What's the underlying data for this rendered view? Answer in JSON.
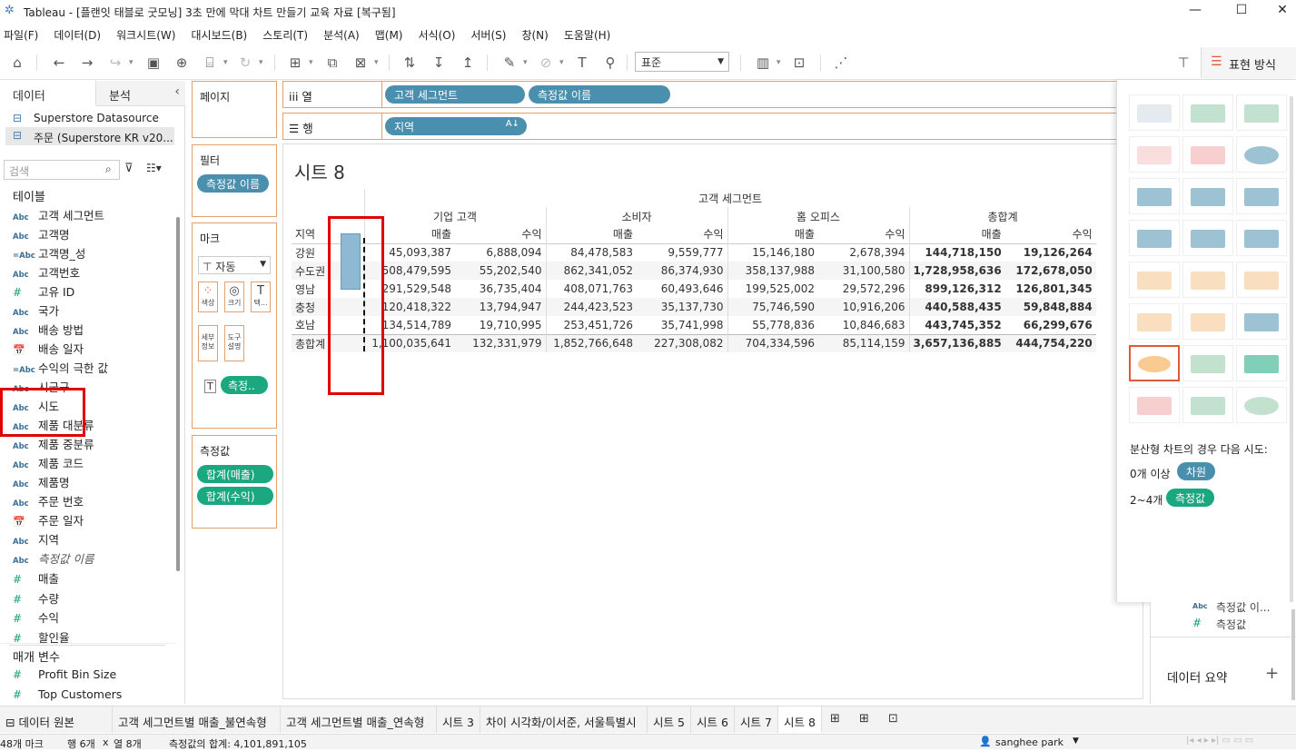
{
  "window": {
    "title": "Tableau - [플랜잇 태블로 굿모닝] 3초 만에 막대 차트 만들기 교육 자료 [복구됨]",
    "min": "—",
    "max": "☐",
    "close": "✕"
  },
  "menu": [
    "파일(F)",
    "데이터(D)",
    "워크시트(W)",
    "대시보드(B)",
    "스토리(T)",
    "분석(A)",
    "맵(M)",
    "서식(O)",
    "서버(S)",
    "창(N)",
    "도움말(H)"
  ],
  "toolbar": {
    "standard": "표준",
    "format_label": "표현 방식"
  },
  "left": {
    "tab_data": "데이터",
    "tab_analysis": "분석",
    "datasources": [
      "Superstore Datasource",
      "주문 (Superstore KR v20..."
    ],
    "search_placeholder": "검색",
    "tables_header": "테이블",
    "fields": [
      {
        "icon": "Abc",
        "name": "고객 세그먼트"
      },
      {
        "icon": "Abc",
        "name": "고객명"
      },
      {
        "icon": "=Abc",
        "name": "고객명_성"
      },
      {
        "icon": "Abc",
        "name": "고객번호"
      },
      {
        "icon": "#",
        "name": "고유 ID"
      },
      {
        "icon": "Abc",
        "name": "국가"
      },
      {
        "icon": "Abc",
        "name": "배송 방법"
      },
      {
        "icon": "cal",
        "name": "배송 일자"
      },
      {
        "icon": "=Abc",
        "name": "수익의 극한 값"
      },
      {
        "icon": "Abc",
        "name": "시군구"
      },
      {
        "icon": "Abc",
        "name": "시도"
      },
      {
        "icon": "Abc",
        "name": "제품 대분류"
      },
      {
        "icon": "Abc",
        "name": "제품 중분류"
      },
      {
        "icon": "Abc",
        "name": "제품 코드"
      },
      {
        "icon": "Abc",
        "name": "제품명"
      },
      {
        "icon": "Abc",
        "name": "주문 번호"
      },
      {
        "icon": "cal",
        "name": "주문 일자"
      },
      {
        "icon": "Abc",
        "name": "지역"
      },
      {
        "icon": "Abc",
        "name": "측정값 이름"
      }
    ],
    "measures": [
      {
        "icon": "#",
        "name": "매출"
      },
      {
        "icon": "#",
        "name": "수량"
      },
      {
        "icon": "#",
        "name": "수익"
      },
      {
        "icon": "#",
        "name": "할인율"
      }
    ],
    "params_header": "매개 변수",
    "params": [
      {
        "icon": "#",
        "name": "Profit Bin Size"
      },
      {
        "icon": "#",
        "name": "Top Customers"
      }
    ]
  },
  "cards": {
    "pages": "페이지",
    "filters": "필터",
    "filter_pill": "측정값 이름",
    "marks": "마크",
    "marks_type": "자동",
    "mark_btns": [
      "색상",
      "크기",
      "텍...",
      "세부\n정보",
      "도구\n설명"
    ],
    "marks_pill": "측정..",
    "measures": "측정값",
    "measure_pills": [
      "합계(매출)",
      "합계(수익)"
    ]
  },
  "shelves": {
    "columns_label": "열",
    "rows_label": "행",
    "columns": [
      "고객 세그먼트",
      "측정값 이름"
    ],
    "rows": [
      "지역"
    ]
  },
  "sheet": {
    "title": "시트 8"
  },
  "crosstab": {
    "top_header": "고객 세그먼트",
    "row_header": "지역",
    "segments": [
      "기업 고객",
      "소비자",
      "홈 오피스",
      "총합계"
    ],
    "measures": [
      "매출",
      "수익"
    ],
    "rows": [
      {
        "region": "강원",
        "values": [
          "45,093,387",
          "6,888,094",
          "84,478,583",
          "9,559,777",
          "15,146,180",
          "2,678,394",
          "144,718,150",
          "19,126,264"
        ]
      },
      {
        "region": "수도권",
        "values": [
          "508,479,595",
          "55,202,540",
          "862,341,052",
          "86,374,930",
          "358,137,988",
          "31,100,580",
          "1,728,958,636",
          "172,678,050"
        ]
      },
      {
        "region": "영남",
        "values": [
          "291,529,548",
          "36,735,404",
          "408,071,763",
          "60,493,646",
          "199,525,002",
          "29,572,296",
          "899,126,312",
          "126,801,345"
        ]
      },
      {
        "region": "충청",
        "values": [
          "120,418,322",
          "13,794,947",
          "244,423,523",
          "35,137,730",
          "75,746,590",
          "10,916,206",
          "440,588,435",
          "59,848,884"
        ]
      },
      {
        "region": "호남",
        "values": [
          "134,514,789",
          "19,710,995",
          "253,451,726",
          "35,741,998",
          "55,778,836",
          "10,846,683",
          "443,745,352",
          "66,299,676"
        ]
      },
      {
        "region": "총합계",
        "values": [
          "1,100,035,641",
          "132,331,979",
          "1,852,766,648",
          "227,308,082",
          "704,334,596",
          "85,114,159",
          "3,657,136,885",
          "444,754,220"
        ]
      }
    ]
  },
  "showme": {
    "hint": "분산형 차트의 경우 다음 시도:",
    "req1": "0개 이상",
    "pill1": "차원",
    "req2": "2~4개",
    "pill2": "측정값"
  },
  "below": {
    "item1": "측정값 이...",
    "item2": "측정값",
    "summary": "데이터 요약",
    "plus": "+"
  },
  "tabs": [
    "데이터 원본",
    "고객 세그먼트별 매출_불연속형",
    "고객 세그먼트별 매출_연속형",
    "시트 3",
    "차이 시각화/이서준, 서울특별시",
    "시트 5",
    "시트 6",
    "시트 7",
    "시트 8"
  ],
  "status": {
    "marks": "48개 마크",
    "rows": "행 6개",
    "x": "x",
    "cols": "열 8개",
    "sum": "측정값의 합계: 4,101,891,105",
    "user": "sanghee park"
  },
  "colors": {
    "orange": "#e4a06b",
    "green": "#1ba780",
    "blue": "#4b8fae",
    "red": "#e00000"
  }
}
